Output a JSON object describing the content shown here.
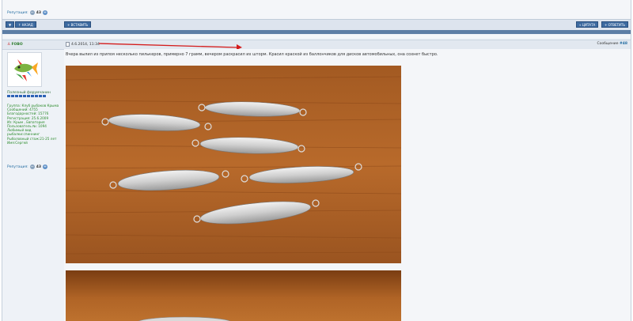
{
  "top": {
    "reputation_label": "Репутация:",
    "reputation_value": "43"
  },
  "toolbar": {
    "btn_small": "▼",
    "btn_back": "↑ НАЗАД",
    "btn_insert": "+ ВСТАВИТЬ",
    "btn_quote": "« ЦИТАТА",
    "btn_reply": "+ ОТВЕТИТЬ"
  },
  "post": {
    "author": "FOBO",
    "date": "4.6.2014, 11:34",
    "number_label": "Сообщение",
    "number": "#48",
    "text": "Вчера вылил из припоя несколько пилькеров, примерно 7 грамм, вечером раскрасил их шторм. Красил краской из баллончиков для дисков автомобильных, она сохнет быстро."
  },
  "user": {
    "title": "Полезный форумчанин",
    "info": [
      "Группа: Клуб рыбаков Крыма",
      "Сообщений: 4755",
      "Благодарностей: 15776",
      "Регистрация: 25.6.2009",
      "Из: Крым , Евпатория",
      "Пользователь №: 1094",
      "Любимый вид",
      "рыбалки:спиннинг",
      "Рыболовный стаж:21-25 лет",
      "Имя:Сергей"
    ],
    "reputation_label": "Репутация:",
    "reputation_value": "43"
  },
  "colors": {
    "toolbar_button": "#3d6aa0",
    "bar": "#5d7ea5",
    "green_text": "#2a8a2a",
    "link": "#1f6aa0"
  }
}
